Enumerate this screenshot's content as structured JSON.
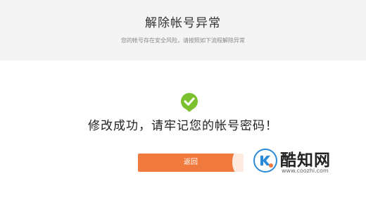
{
  "header": {
    "title": "解除帐号异常",
    "subtitle": "您的帐号存在安全风险，请按照如下流程解除异常"
  },
  "status": {
    "icon": "check-icon",
    "icon_color": "#7cbf2f",
    "message": "修改成功，请牢记您的帐号密码！"
  },
  "actions": {
    "return_label": "返回",
    "return_color": "#f07a3e"
  },
  "watermark": {
    "name": "酷知网",
    "url": "www.coozhi.com",
    "logo_color": "#2b8ad8"
  }
}
